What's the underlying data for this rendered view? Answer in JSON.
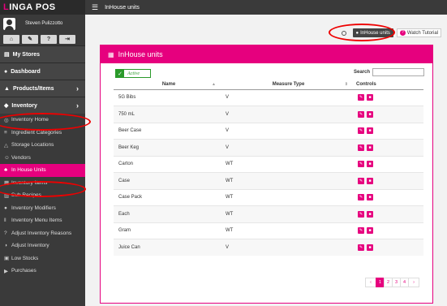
{
  "app": {
    "logo_first": "L",
    "logo_rest": "INGA POS",
    "page_title": "InHouse units"
  },
  "user": {
    "name": "Steven Pulizzotto",
    "buttons": [
      "⌂",
      "✎",
      "?",
      "⇥"
    ]
  },
  "sidebar": {
    "sections": [
      {
        "label": "My Stores",
        "icon": "▤"
      },
      {
        "label": "Dashboard",
        "icon": "●"
      },
      {
        "label": "Products/Items",
        "icon": "▲",
        "chevron": "›"
      },
      {
        "label": "Inventory",
        "icon": "◆",
        "chevron": "›"
      }
    ],
    "items": [
      {
        "label": "Inventory Home",
        "icon": "◎"
      },
      {
        "label": "Ingredient Categories",
        "icon": "≡"
      },
      {
        "label": "Storage Locations",
        "icon": "△"
      },
      {
        "label": "Vendors",
        "icon": "☺"
      },
      {
        "label": "In House Units",
        "icon": "♣",
        "active": true
      },
      {
        "label": "Inventory Items",
        "icon": "▦"
      },
      {
        "label": "Sub Recipes",
        "icon": "▥"
      },
      {
        "label": "Inventory Modifiers",
        "icon": "●"
      },
      {
        "label": "Inventory Menu Items",
        "icon": "‖"
      },
      {
        "label": "Adjust Inventory Reasons",
        "icon": "?"
      },
      {
        "label": "Adjust Inventory",
        "icon": "◑"
      },
      {
        "label": "Low Stocks",
        "icon": "▣"
      },
      {
        "label": "Purchases",
        "icon": "▶"
      }
    ]
  },
  "toolbar": {
    "inhouse_label": "InHouse units",
    "tutorial_label": "Watch Tutorial",
    "q": "?"
  },
  "panel": {
    "title": "InHouse units",
    "active_label": "Active",
    "search_label": "Search",
    "search_value": ""
  },
  "table": {
    "headers": [
      "Name",
      "Measure Type",
      "Controls"
    ],
    "rows": [
      {
        "name": "5G Bibs",
        "mtype": "V"
      },
      {
        "name": "750 mL",
        "mtype": "V"
      },
      {
        "name": "Beer Case",
        "mtype": "V"
      },
      {
        "name": "Beer Keg",
        "mtype": "V"
      },
      {
        "name": "Carton",
        "mtype": "WT"
      },
      {
        "name": "Case",
        "mtype": "WT"
      },
      {
        "name": "Case Pack",
        "mtype": "WT"
      },
      {
        "name": "Each",
        "mtype": "WT"
      },
      {
        "name": "Gram",
        "mtype": "WT"
      },
      {
        "name": "Juice Can",
        "mtype": "V"
      }
    ]
  },
  "pagination": {
    "prev": "‹",
    "pages": [
      "1",
      "2",
      "3",
      "4"
    ],
    "next": "›",
    "current": "1"
  },
  "colors": {
    "accent": "#e6007e",
    "sidebar": "#3a3a3a",
    "active_green": "#2a9a2a",
    "highlight": "#ee0000"
  }
}
